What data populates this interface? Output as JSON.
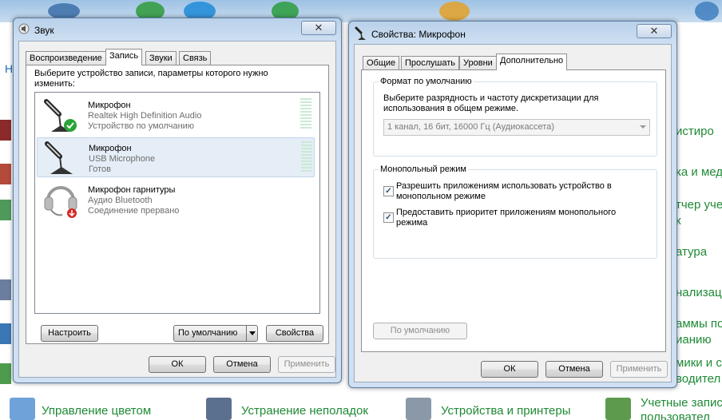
{
  "background": {
    "heading_fragment": "Н",
    "right_fragments": [
      "истиро",
      "ка и мед",
      "тчер уче",
      "к",
      "атура",
      "нализац",
      "аммы по",
      "ианию",
      "мики и ср",
      "водител"
    ],
    "bottom_links": [
      "Управление цветом",
      "Устранение неполадок",
      "Устройства и принтеры",
      "Учетные запис",
      "пользовател"
    ]
  },
  "sound_dialog": {
    "title": "Звук",
    "tabs": [
      "Воспроизведение",
      "Запись",
      "Звуки",
      "Связь"
    ],
    "instructions": "Выберите устройство записи, параметры которого нужно изменить:",
    "devices": [
      {
        "name": "Микрофон",
        "driver": "Realtek High Definition Audio",
        "status": "Устройство по умолчанию",
        "icon": "microphone-default-icon"
      },
      {
        "name": "Микрофон",
        "driver": "USB Microphone",
        "status": "Готов",
        "icon": "microphone-icon"
      },
      {
        "name": "Микрофон гарнитуры",
        "driver": "Аудио Bluetooth",
        "status": "Соединение прервано",
        "icon": "headset-disconnected-icon"
      }
    ],
    "configure_button": "Настроить",
    "default_button": "По умолчанию",
    "properties_button": "Свойства",
    "ok_button": "ОК",
    "cancel_button": "Отмена",
    "apply_button": "Применить"
  },
  "mic_properties": {
    "title": "Свойства: Микрофон",
    "tabs": [
      "Общие",
      "Прослушать",
      "Уровни",
      "Дополнительно"
    ],
    "default_format_group": "Формат по умолчанию",
    "default_format_text": "Выберите разрядность и частоту дискретизации для использования в общем режиме.",
    "format_selected": "1 канал, 16 бит, 16000 Гц (Аудиокассета)",
    "exclusive_group": "Монопольный режим",
    "exclusive_allow": {
      "label": "Разрешить приложениям использовать устройство в монопольном режиме",
      "checked": true
    },
    "exclusive_priority": {
      "label": "Предоставить приоритет приложениям монопольного режима",
      "checked": true
    },
    "restore_defaults_button": "По умолчанию",
    "ok_button": "ОК",
    "cancel_button": "Отмена",
    "apply_button": "Применить"
  },
  "colors": {
    "link_green": "#1e8a35",
    "selection": "#e5eef7",
    "titlebar": "#b9d1ea"
  }
}
